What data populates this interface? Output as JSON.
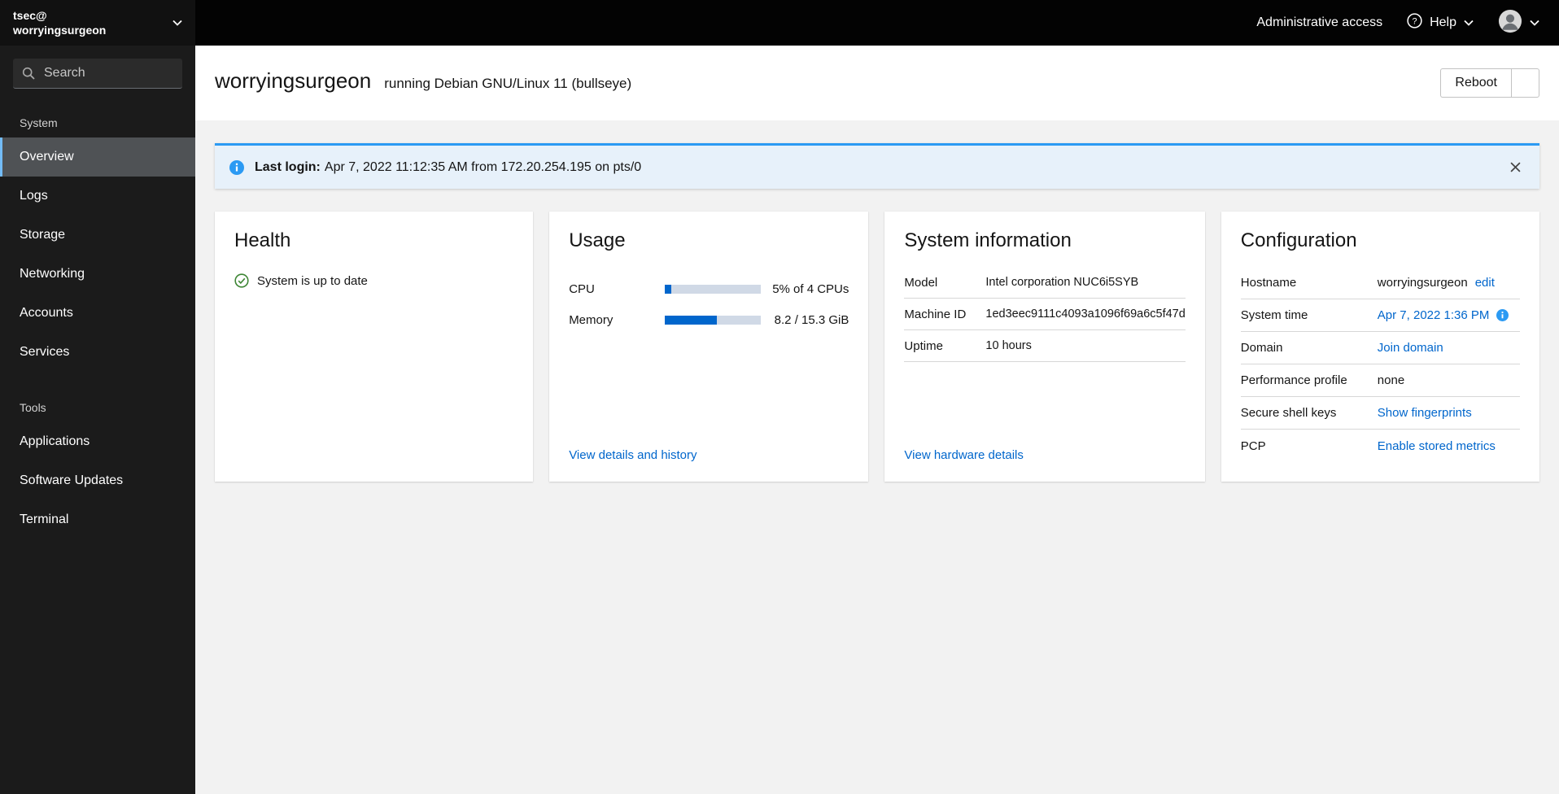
{
  "colors": {
    "link": "#0066cc",
    "info": "#2b9af3",
    "success": "#3e8635",
    "nav_current_accent": "#73bcf7"
  },
  "sidebar": {
    "user_line1": "tsec@",
    "user_line2": "worryingsurgeon",
    "search_placeholder": "Search",
    "current_item": "Overview",
    "sections": [
      {
        "label": "System",
        "items": [
          "Overview",
          "Logs",
          "Storage",
          "Networking",
          "Accounts",
          "Services"
        ]
      },
      {
        "label": "Tools",
        "items": [
          "Applications",
          "Software Updates",
          "Terminal"
        ]
      }
    ]
  },
  "topbar": {
    "admin_access_label": "Administrative access",
    "help_label": "Help"
  },
  "page_header": {
    "hostname": "worryingsurgeon",
    "os_text": "running Debian GNU/Linux 11 (bullseye)",
    "reboot_label": "Reboot"
  },
  "alert": {
    "label": "Last login:",
    "message": "Apr 7, 2022 11:12:35 AM from 172.20.254.195 on pts/0"
  },
  "cards": {
    "health": {
      "title": "Health",
      "status_text": "System is up to date"
    },
    "usage": {
      "title": "Usage",
      "rows": [
        {
          "label": "CPU",
          "percent": 5,
          "value": "5% of 4 CPUs"
        },
        {
          "label": "Memory",
          "percent": 54,
          "value": "8.2 / 15.3 GiB"
        }
      ],
      "footer_link": "View details and history"
    },
    "system_information": {
      "title": "System information",
      "rows": [
        {
          "label": "Model",
          "value": "Intel corporation NUC6i5SYB"
        },
        {
          "label": "Machine ID",
          "value": "1ed3eec9111c4093a1096f69a6c5f47d"
        },
        {
          "label": "Uptime",
          "value": "10 hours"
        }
      ],
      "footer_link": "View hardware details"
    },
    "configuration": {
      "title": "Configuration",
      "rows": [
        {
          "label": "Hostname",
          "value": "worryingsurgeon",
          "action_link": "edit"
        },
        {
          "label": "System time",
          "link": "Apr 7, 2022 1:36 PM"
        },
        {
          "label": "Domain",
          "link": "Join domain"
        },
        {
          "label": "Performance profile",
          "value": "none"
        },
        {
          "label": "Secure shell keys",
          "link": "Show fingerprints"
        },
        {
          "label": "PCP",
          "link": "Enable stored metrics"
        }
      ]
    }
  }
}
